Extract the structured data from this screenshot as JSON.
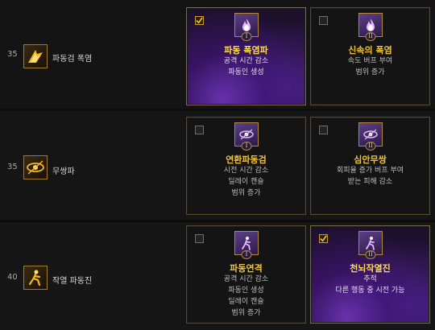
{
  "rows": [
    {
      "level": "35",
      "skill_icon": "sword-slash-icon",
      "skill_name": "파동검 폭염",
      "options": [
        {
          "checked": true,
          "active": true,
          "tier": "I",
          "icon": "purple-flame-icon",
          "title": "파동 폭염파",
          "lines": [
            "공격 시간 감소",
            "파동인 생성"
          ]
        },
        {
          "checked": false,
          "active": false,
          "tier": "II",
          "icon": "purple-flame-icon",
          "title": "신속의 폭염",
          "lines": [
            "속도 버프 부여",
            "범위 증가"
          ]
        }
      ]
    },
    {
      "level": "35",
      "skill_icon": "eye-wave-icon",
      "skill_name": "무쌍파",
      "options": [
        {
          "checked": false,
          "active": false,
          "tier": "I",
          "icon": "purple-eye-icon",
          "title": "연환파동검",
          "lines": [
            "시전 시간 감소",
            "딜레이 캔슬",
            "범위 증가"
          ]
        },
        {
          "checked": false,
          "active": false,
          "tier": "II",
          "icon": "purple-eye-icon",
          "title": "심안무쌍",
          "lines": [
            "회피율 증가 버프 부여",
            "받는 피해 감소"
          ]
        }
      ]
    },
    {
      "level": "40",
      "skill_icon": "dashing-figure-icon",
      "skill_name": "작열 파동진",
      "options": [
        {
          "checked": false,
          "active": false,
          "tier": "I",
          "icon": "purple-figure-icon",
          "title": "파동연격",
          "lines": [
            "공격 시간 감소",
            "파동인 생성",
            "딜레이 캔슬",
            "범위 증가"
          ]
        },
        {
          "checked": true,
          "active": true,
          "tier": "II",
          "icon": "purple-figure-icon",
          "title": "천뇌작열진",
          "lines": [
            "추적",
            "다른 행동 중 시전 가능"
          ]
        }
      ]
    }
  ]
}
